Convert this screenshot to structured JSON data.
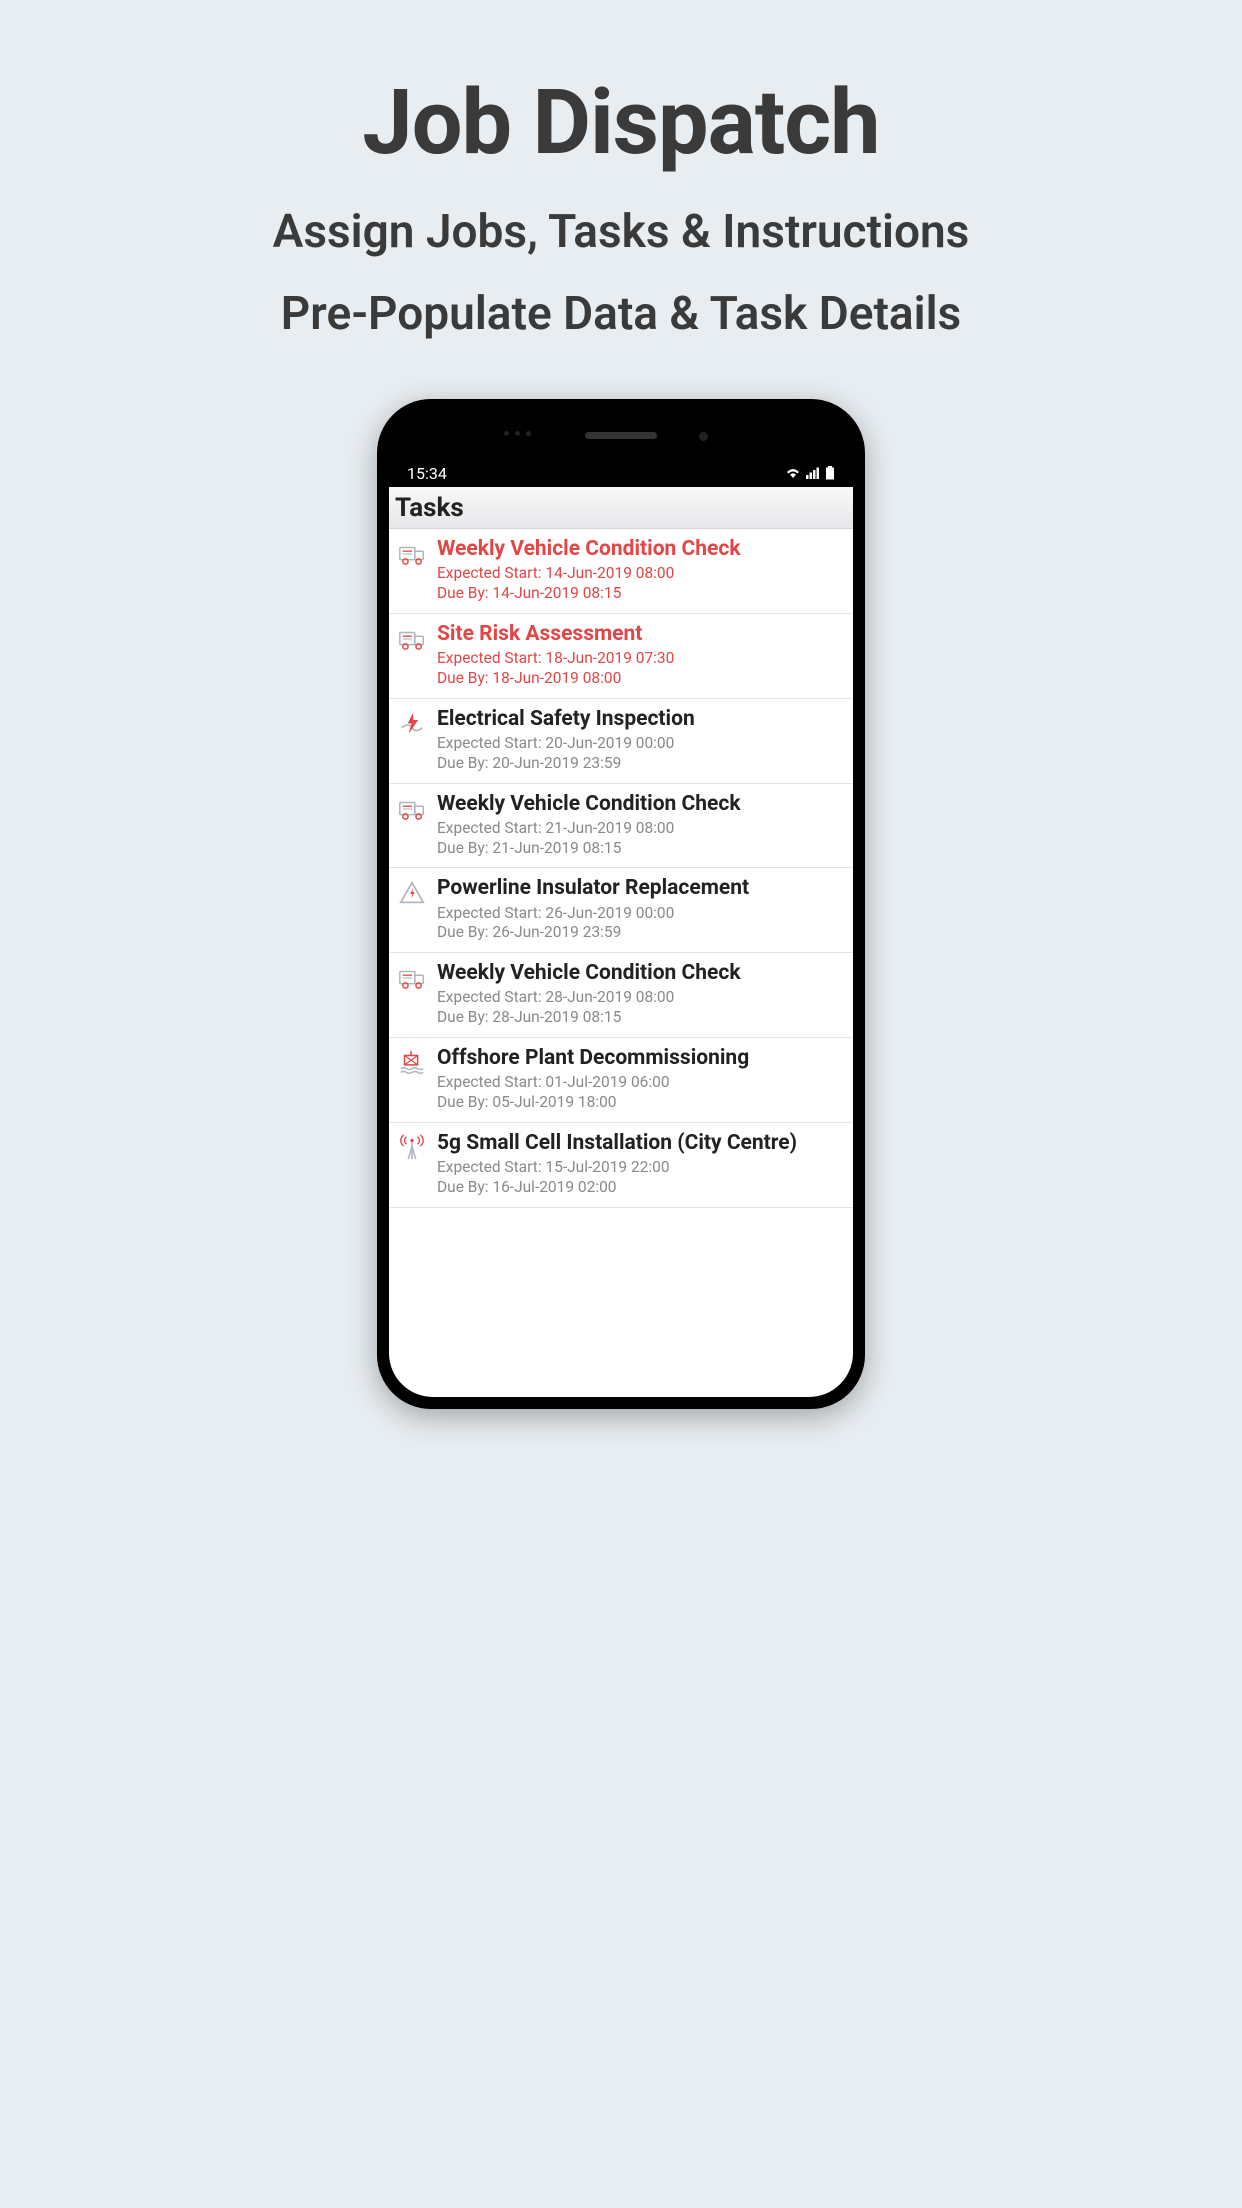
{
  "promo": {
    "title": "Job Dispatch",
    "subtitle1": "Assign Jobs, Tasks & Instructions",
    "subtitle2": "Pre-Populate Data & Task Details"
  },
  "status": {
    "time": "15:34"
  },
  "app": {
    "header_title": "Tasks"
  },
  "labels": {
    "expected_start_prefix": "Expected Start: ",
    "due_by_prefix": "Due By: "
  },
  "tasks": [
    {
      "icon": "truck-icon",
      "title": "Weekly Vehicle Condition Check",
      "expected_start": "14-Jun-2019 08:00",
      "due_by": "14-Jun-2019 08:15",
      "overdue": true
    },
    {
      "icon": "truck-icon",
      "title": "Site Risk Assessment",
      "expected_start": "18-Jun-2019 07:30",
      "due_by": "18-Jun-2019 08:00",
      "overdue": true
    },
    {
      "icon": "electrical-icon",
      "title": "Electrical Safety Inspection",
      "expected_start": "20-Jun-2019 00:00",
      "due_by": "20-Jun-2019 23:59",
      "overdue": false
    },
    {
      "icon": "truck-icon",
      "title": "Weekly Vehicle Condition Check",
      "expected_start": "21-Jun-2019 08:00",
      "due_by": "21-Jun-2019 08:15",
      "overdue": false
    },
    {
      "icon": "warning-icon",
      "title": "Powerline Insulator Replacement",
      "expected_start": "26-Jun-2019 00:00",
      "due_by": "26-Jun-2019 23:59",
      "overdue": false
    },
    {
      "icon": "truck-icon",
      "title": "Weekly Vehicle Condition Check",
      "expected_start": "28-Jun-2019 08:00",
      "due_by": "28-Jun-2019 08:15",
      "overdue": false
    },
    {
      "icon": "offshore-icon",
      "title": "Offshore Plant Decommissioning",
      "expected_start": "01-Jul-2019 06:00",
      "due_by": "05-Jul-2019 18:00",
      "overdue": false
    },
    {
      "icon": "antenna-icon",
      "title": "5g Small Cell Installation (City Centre)",
      "expected_start": "15-Jul-2019 22:00",
      "due_by": "16-Jul-2019 02:00",
      "overdue": false
    }
  ]
}
